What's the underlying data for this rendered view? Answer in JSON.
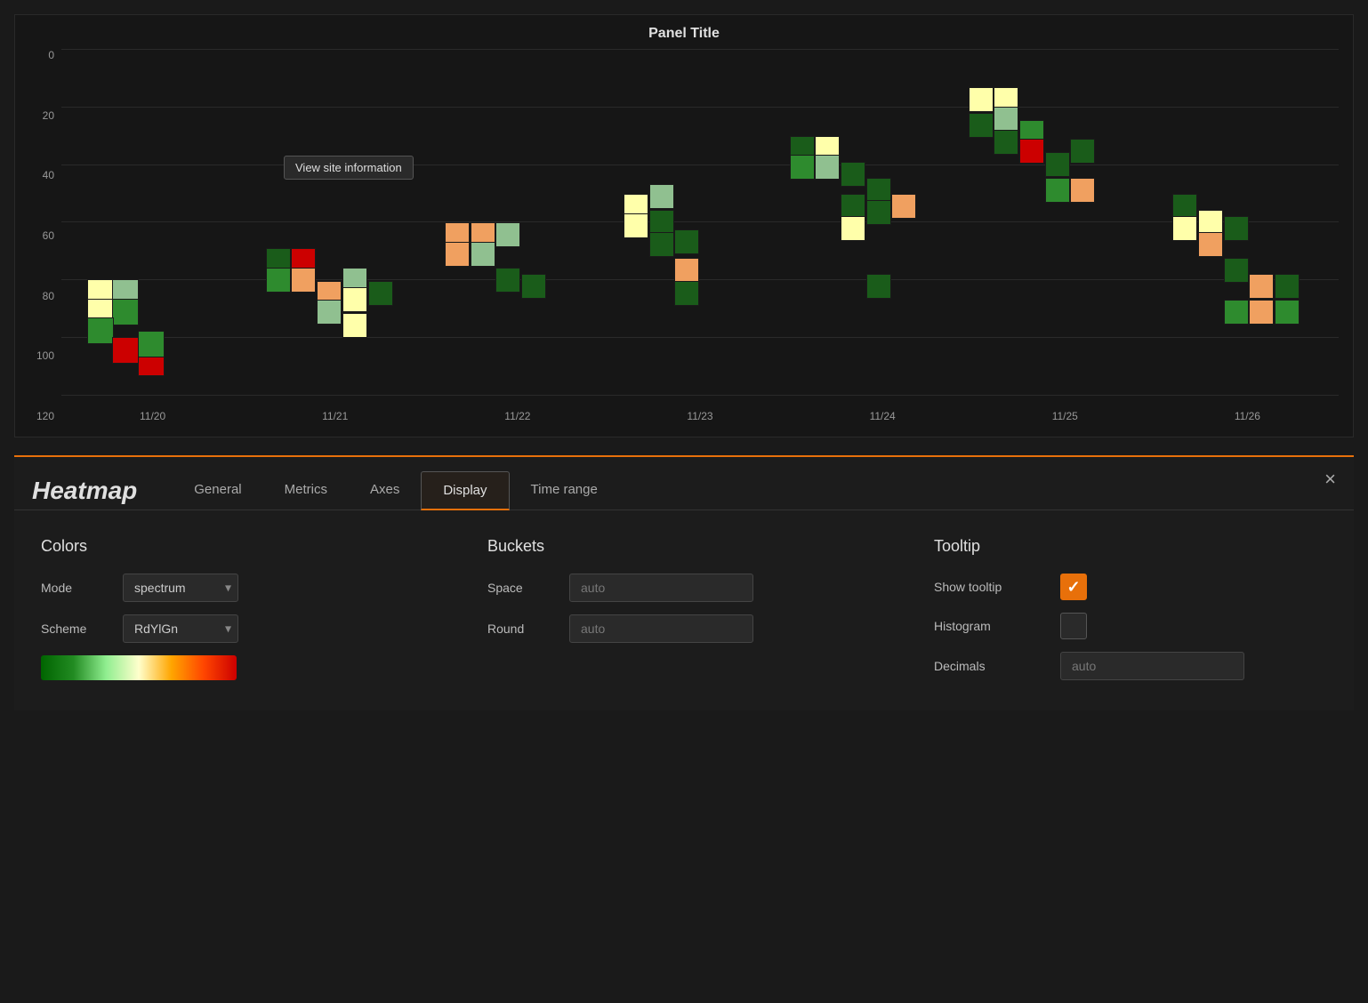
{
  "chart": {
    "title": "Panel Title",
    "tooltip": "View site information",
    "y_labels": [
      "0",
      "20",
      "40",
      "60",
      "80",
      "100",
      "120"
    ],
    "x_labels": [
      "11/20",
      "11/21",
      "11/22",
      "11/23",
      "11/24",
      "11/25",
      "11/26"
    ]
  },
  "settings": {
    "title": "Heatmap",
    "tabs": [
      "General",
      "Metrics",
      "Axes",
      "Display",
      "Time range"
    ],
    "active_tab": "Display",
    "close_label": "×",
    "sections": {
      "colors": {
        "title": "Colors",
        "mode_label": "Mode",
        "mode_value": "spectrum",
        "scheme_label": "Scheme",
        "scheme_value": "RdYlGn"
      },
      "buckets": {
        "title": "Buckets",
        "space_label": "Space",
        "space_value": "auto",
        "round_label": "Round",
        "round_value": "auto"
      },
      "tooltip": {
        "title": "Tooltip",
        "show_tooltip_label": "Show tooltip",
        "show_tooltip_checked": true,
        "histogram_label": "Histogram",
        "histogram_checked": false,
        "decimals_label": "Decimals",
        "decimals_value": "auto"
      }
    }
  }
}
